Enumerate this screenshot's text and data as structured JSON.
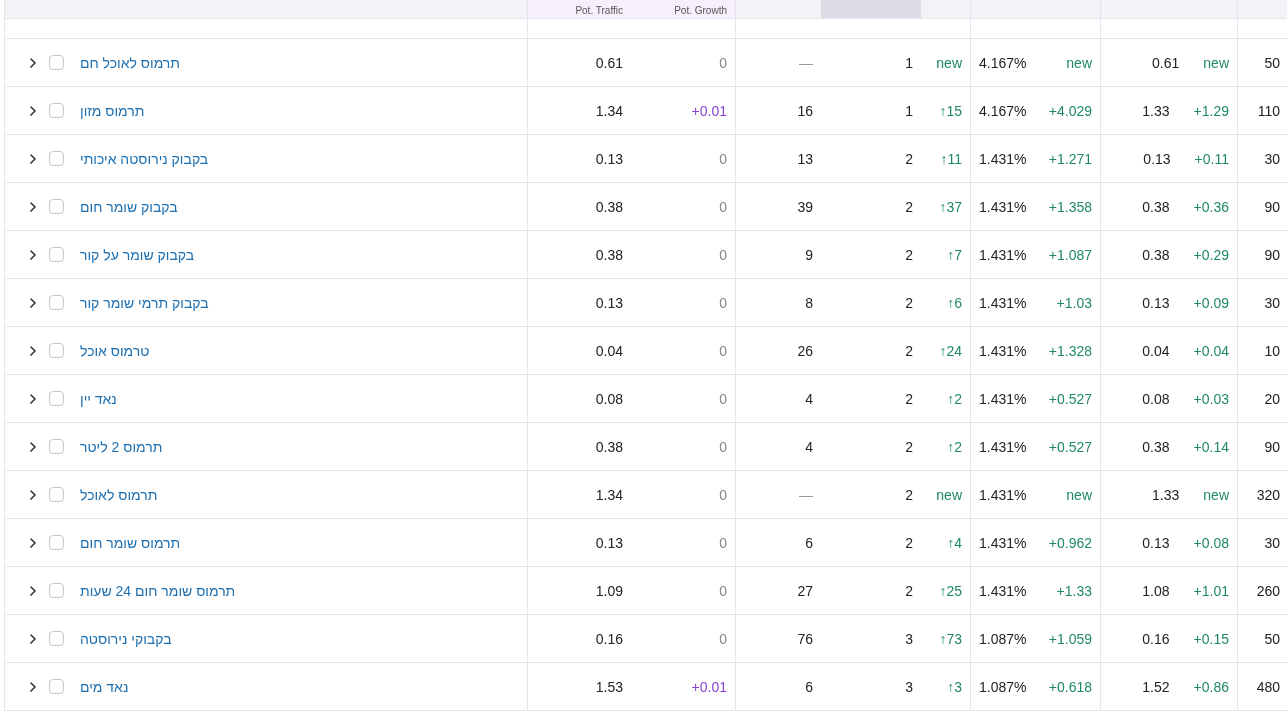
{
  "table": {
    "columns": [
      {
        "kind": "metric",
        "selected": false
      },
      {
        "label": "Pot. Traffic",
        "kind": "potential",
        "selected": false
      },
      {
        "label": "Pot. Growth",
        "kind": "potential",
        "selected": false
      },
      {
        "kind": "metric",
        "selected": false
      },
      {
        "kind": "metric",
        "selected": true
      },
      {
        "kind": "metric",
        "selected": false
      },
      {
        "kind": "metric",
        "selected": false
      },
      {
        "kind": "metric",
        "selected": false
      },
      {
        "kind": "metric",
        "selected": false
      }
    ],
    "rows": [
      {
        "keyword": "תרמוס לאוכל חם",
        "checked": false,
        "expanded": false,
        "pot_traffic": "0.61",
        "pot_growth": {
          "text": "0",
          "kind": "zero"
        },
        "column_4": {
          "text": "—",
          "kind": "none"
        },
        "column_5": "1",
        "column_5_change": "new",
        "column_6": "4.167%",
        "column_6_change": "new",
        "column_7": "0.61",
        "column_7_change": "new",
        "column_8": "50"
      },
      {
        "keyword": "תרמוס מזון",
        "checked": false,
        "expanded": false,
        "pot_traffic": "1.34",
        "pot_growth": {
          "text": "+0.01",
          "kind": "up"
        },
        "column_4": {
          "text": "16",
          "kind": "value"
        },
        "column_5": "1",
        "column_5_change": "↑15",
        "column_6": "4.167%",
        "column_6_change": "+4.029",
        "column_7": "1.33",
        "column_7_change": "+1.29",
        "column_8": "110"
      },
      {
        "keyword": "בקבוק נירוסטה איכותי",
        "checked": false,
        "expanded": false,
        "pot_traffic": "0.13",
        "pot_growth": {
          "text": "0",
          "kind": "zero"
        },
        "column_4": {
          "text": "13",
          "kind": "value"
        },
        "column_5": "2",
        "column_5_change": "↑11",
        "column_6": "1.431%",
        "column_6_change": "+1.271",
        "column_7": "0.13",
        "column_7_change": "+0.11",
        "column_8": "30"
      },
      {
        "keyword": "בקבוק שומר חום",
        "checked": false,
        "expanded": false,
        "pot_traffic": "0.38",
        "pot_growth": {
          "text": "0",
          "kind": "zero"
        },
        "column_4": {
          "text": "39",
          "kind": "value"
        },
        "column_5": "2",
        "column_5_change": "↑37",
        "column_6": "1.431%",
        "column_6_change": "+1.358",
        "column_7": "0.38",
        "column_7_change": "+0.36",
        "column_8": "90"
      },
      {
        "keyword": "בקבוק שומר על קור",
        "checked": false,
        "expanded": false,
        "pot_traffic": "0.38",
        "pot_growth": {
          "text": "0",
          "kind": "zero"
        },
        "column_4": {
          "text": "9",
          "kind": "value"
        },
        "column_5": "2",
        "column_5_change": "↑7",
        "column_6": "1.431%",
        "column_6_change": "+1.087",
        "column_7": "0.38",
        "column_7_change": "+0.29",
        "column_8": "90"
      },
      {
        "keyword": "בקבוק תרמי שומר קור",
        "checked": false,
        "expanded": false,
        "pot_traffic": "0.13",
        "pot_growth": {
          "text": "0",
          "kind": "zero"
        },
        "column_4": {
          "text": "8",
          "kind": "value"
        },
        "column_5": "2",
        "column_5_change": "↑6",
        "column_6": "1.431%",
        "column_6_change": "+1.03",
        "column_7": "0.13",
        "column_7_change": "+0.09",
        "column_8": "30"
      },
      {
        "keyword": "טרמוס אוכל",
        "checked": false,
        "expanded": false,
        "pot_traffic": "0.04",
        "pot_growth": {
          "text": "0",
          "kind": "zero"
        },
        "column_4": {
          "text": "26",
          "kind": "value"
        },
        "column_5": "2",
        "column_5_change": "↑24",
        "column_6": "1.431%",
        "column_6_change": "+1.328",
        "column_7": "0.04",
        "column_7_change": "+0.04",
        "column_8": "10"
      },
      {
        "keyword": "נאד יין",
        "checked": false,
        "expanded": false,
        "pot_traffic": "0.08",
        "pot_growth": {
          "text": "0",
          "kind": "zero"
        },
        "column_4": {
          "text": "4",
          "kind": "value"
        },
        "column_5": "2",
        "column_5_change": "↑2",
        "column_6": "1.431%",
        "column_6_change": "+0.527",
        "column_7": "0.08",
        "column_7_change": "+0.03",
        "column_8": "20"
      },
      {
        "keyword": "תרמוס 2 ליטר",
        "checked": false,
        "expanded": false,
        "pot_traffic": "0.38",
        "pot_growth": {
          "text": "0",
          "kind": "zero"
        },
        "column_4": {
          "text": "4",
          "kind": "value"
        },
        "column_5": "2",
        "column_5_change": "↑2",
        "column_6": "1.431%",
        "column_6_change": "+0.527",
        "column_7": "0.38",
        "column_7_change": "+0.14",
        "column_8": "90"
      },
      {
        "keyword": "תרמוס לאוכל",
        "checked": false,
        "expanded": false,
        "pot_traffic": "1.34",
        "pot_growth": {
          "text": "0",
          "kind": "zero"
        },
        "column_4": {
          "text": "—",
          "kind": "none"
        },
        "column_5": "2",
        "column_5_change": "new",
        "column_6": "1.431%",
        "column_6_change": "new",
        "column_7": "1.33",
        "column_7_change": "new",
        "column_8": "320"
      },
      {
        "keyword": "תרמוס שומר חום",
        "checked": false,
        "expanded": false,
        "pot_traffic": "0.13",
        "pot_growth": {
          "text": "0",
          "kind": "zero"
        },
        "column_4": {
          "text": "6",
          "kind": "value"
        },
        "column_5": "2",
        "column_5_change": "↑4",
        "column_6": "1.431%",
        "column_6_change": "+0.962",
        "column_7": "0.13",
        "column_7_change": "+0.08",
        "column_8": "30"
      },
      {
        "keyword": "תרמוס שומר חום 24 שעות",
        "checked": false,
        "expanded": false,
        "pot_traffic": "1.09",
        "pot_growth": {
          "text": "0",
          "kind": "zero"
        },
        "column_4": {
          "text": "27",
          "kind": "value"
        },
        "column_5": "2",
        "column_5_change": "↑25",
        "column_6": "1.431%",
        "column_6_change": "+1.33",
        "column_7": "1.08",
        "column_7_change": "+1.01",
        "column_8": "260"
      },
      {
        "keyword": "בקבוקי נירוסטה",
        "checked": false,
        "expanded": false,
        "pot_traffic": "0.16",
        "pot_growth": {
          "text": "0",
          "kind": "zero"
        },
        "column_4": {
          "text": "76",
          "kind": "value"
        },
        "column_5": "3",
        "column_5_change": "↑73",
        "column_6": "1.087%",
        "column_6_change": "+1.059",
        "column_7": "0.16",
        "column_7_change": "+0.15",
        "column_8": "50"
      },
      {
        "keyword": "נאד מים",
        "checked": false,
        "expanded": false,
        "pot_traffic": "1.53",
        "pot_growth": {
          "text": "+0.01",
          "kind": "up"
        },
        "column_4": {
          "text": "6",
          "kind": "value"
        },
        "column_5": "3",
        "column_5_change": "↑3",
        "column_6": "1.087%",
        "column_6_change": "+0.618",
        "column_7": "1.52",
        "column_7_change": "+0.86",
        "column_8": "480"
      }
    ]
  }
}
